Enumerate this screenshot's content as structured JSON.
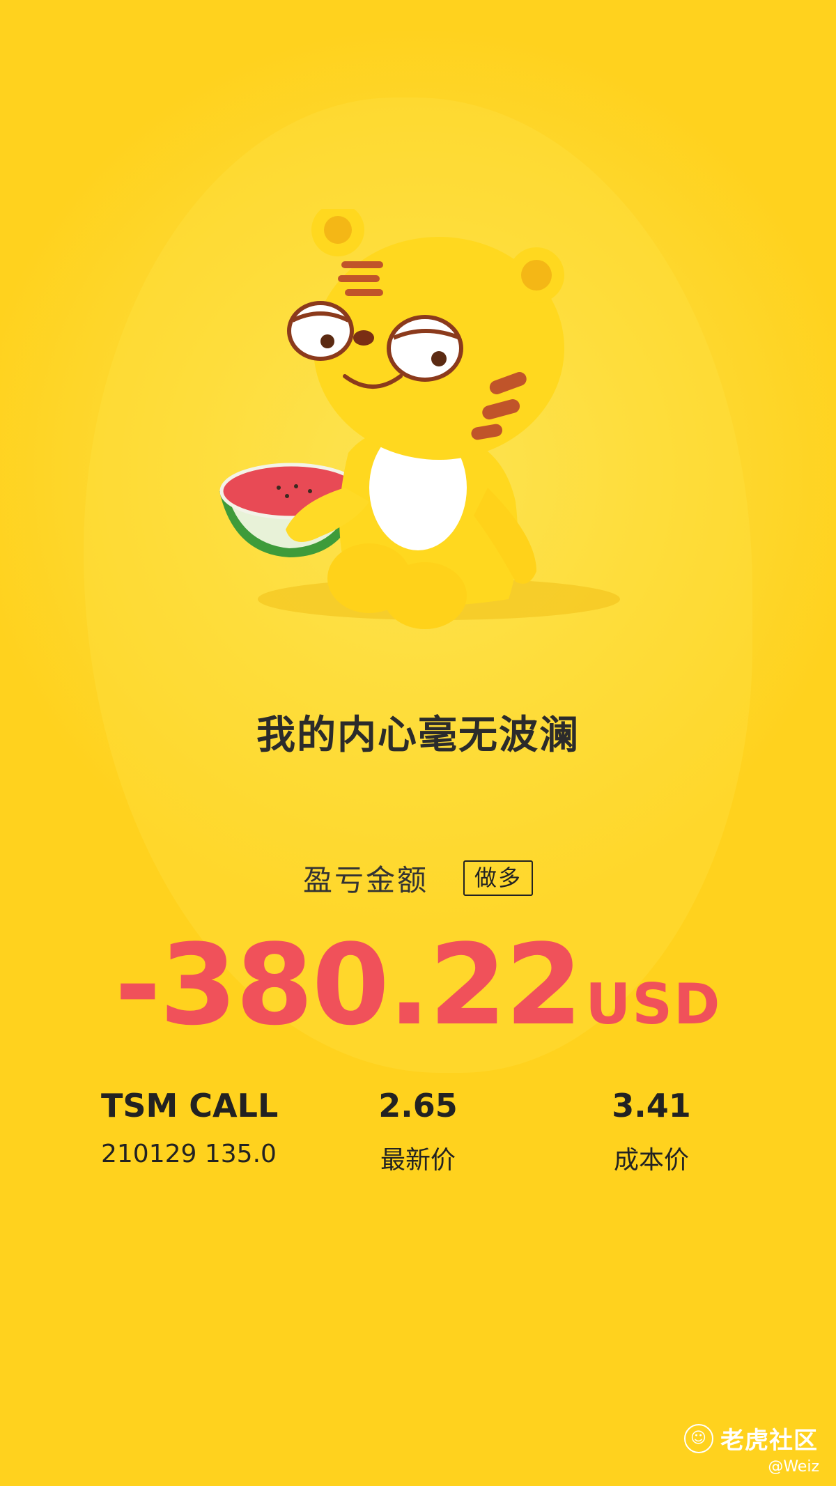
{
  "tagline": "我的内心毫无波澜",
  "pnl": {
    "label": "盈亏金额",
    "direction_badge": "做多",
    "amount": "-380.22",
    "currency": "USD",
    "color": "#F0515A"
  },
  "position": {
    "symbol": "TSM CALL",
    "contract": "210129 135.0",
    "latest_price": "2.65",
    "latest_price_label": "最新价",
    "cost_price": "3.41",
    "cost_price_label": "成本价"
  },
  "watermark": {
    "brand": "老虎社区",
    "handle": "@Weiz"
  },
  "theme": {
    "background": "#FFD21E",
    "text": "#222222"
  }
}
